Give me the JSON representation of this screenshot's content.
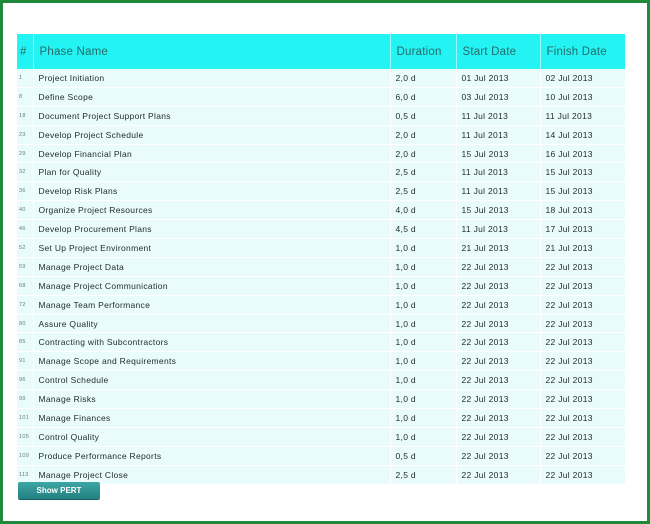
{
  "table": {
    "headers": {
      "num": "#",
      "phase": "Phase Name",
      "duration": "Duration",
      "start": "Start Date",
      "finish": "Finish Date"
    },
    "rows": [
      {
        "num": "1",
        "phase": "Project Initiation",
        "duration": "2,0 d",
        "start": "01 Jul 2013",
        "finish": "02 Jul 2013"
      },
      {
        "num": "8",
        "phase": "Define Scope",
        "duration": "6,0 d",
        "start": "03 Jul 2013",
        "finish": "10 Jul 2013"
      },
      {
        "num": "18",
        "phase": "Document Project Support Plans",
        "duration": "0,5 d",
        "start": "11 Jul 2013",
        "finish": "11 Jul 2013"
      },
      {
        "num": "23",
        "phase": "Develop Project Schedule",
        "duration": "2,0 d",
        "start": "11 Jul 2013",
        "finish": "14 Jul 2013"
      },
      {
        "num": "29",
        "phase": "Develop Financial Plan",
        "duration": "2,0 d",
        "start": "15 Jul 2013",
        "finish": "16 Jul 2013"
      },
      {
        "num": "32",
        "phase": "Plan for Quality",
        "duration": "2,5 d",
        "start": "11 Jul 2013",
        "finish": "15 Jul 2013"
      },
      {
        "num": "36",
        "phase": "Develop Risk Plans",
        "duration": "2,5 d",
        "start": "11 Jul 2013",
        "finish": "15 Jul 2013"
      },
      {
        "num": "40",
        "phase": "Organize Project Resources",
        "duration": "4,0 d",
        "start": "15 Jul 2013",
        "finish": "18 Jul 2013"
      },
      {
        "num": "46",
        "phase": "Develop Procurement Plans",
        "duration": "4,5 d",
        "start": "11 Jul 2013",
        "finish": "17 Jul 2013"
      },
      {
        "num": "52",
        "phase": "Set Up Project Environment",
        "duration": "1,0 d",
        "start": "21 Jul 2013",
        "finish": "21 Jul 2013"
      },
      {
        "num": "59",
        "phase": "Manage Project Data",
        "duration": "1,0 d",
        "start": "22 Jul 2013",
        "finish": "22 Jul 2013"
      },
      {
        "num": "68",
        "phase": "Manage Project Communication",
        "duration": "1,0 d",
        "start": "22 Jul 2013",
        "finish": "22 Jul 2013"
      },
      {
        "num": "72",
        "phase": "Manage Team Performance",
        "duration": "1,0 d",
        "start": "22 Jul 2013",
        "finish": "22 Jul 2013"
      },
      {
        "num": "80",
        "phase": "Assure Quality",
        "duration": "1,0 d",
        "start": "22 Jul 2013",
        "finish": "22 Jul 2013"
      },
      {
        "num": "85",
        "phase": "Contracting with Subcontractors",
        "duration": "1,0 d",
        "start": "22 Jul 2013",
        "finish": "22 Jul 2013"
      },
      {
        "num": "91",
        "phase": "Manage Scope and Requirements",
        "duration": "1,0 d",
        "start": "22 Jul 2013",
        "finish": "22 Jul 2013"
      },
      {
        "num": "96",
        "phase": "Control Schedule",
        "duration": "1,0 d",
        "start": "22 Jul 2013",
        "finish": "22 Jul 2013"
      },
      {
        "num": "99",
        "phase": "Manage Risks",
        "duration": "1,0 d",
        "start": "22 Jul 2013",
        "finish": "22 Jul 2013"
      },
      {
        "num": "101",
        "phase": "Manage Finances",
        "duration": "1,0 d",
        "start": "22 Jul 2013",
        "finish": "22 Jul 2013"
      },
      {
        "num": "105",
        "phase": "Control Quality",
        "duration": "1,0 d",
        "start": "22 Jul 2013",
        "finish": "22 Jul 2013"
      },
      {
        "num": "109",
        "phase": "Produce Performance Reports",
        "duration": "0,5 d",
        "start": "22 Jul 2013",
        "finish": "22 Jul 2013"
      },
      {
        "num": "113",
        "phase": "Manage Project Close",
        "duration": "2,5 d",
        "start": "22 Jul 2013",
        "finish": "22 Jul 2013"
      }
    ]
  },
  "buttons": {
    "show_pert": "Show PERT"
  },
  "colors": {
    "header_bg": "#24f3f3",
    "row_bg": "#e9fbfb",
    "button_bg": "#2f9394",
    "frame_border": "#1f8a3a"
  }
}
